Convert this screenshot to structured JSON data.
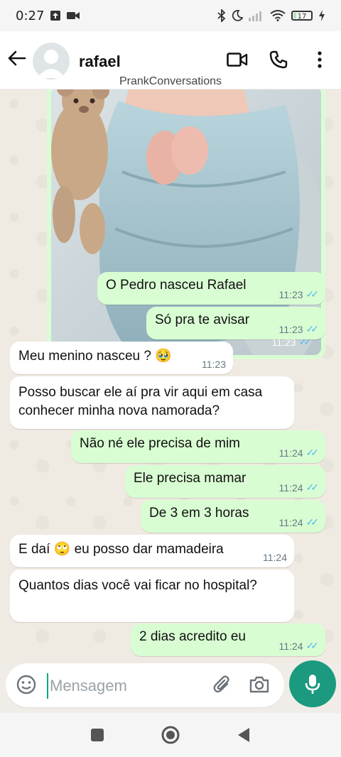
{
  "status_bar": {
    "time": "0:27",
    "battery": "17"
  },
  "header": {
    "contact_name": "rafael",
    "watermark": "PrankConversations"
  },
  "image_message": {
    "time": "11:23"
  },
  "messages": [
    {
      "direction": "out",
      "text": "O Pedro nasceu Rafael",
      "time": "11:23"
    },
    {
      "direction": "out",
      "text": "Só pra te avisar",
      "time": "11:23"
    },
    {
      "direction": "in",
      "text": "Meu menino nasceu ? 🥹",
      "time": "11:23"
    },
    {
      "direction": "in",
      "text": "Posso buscar ele aí pra vir aqui em casa conhecer minha nova namorada?",
      "time": ""
    },
    {
      "direction": "out",
      "text": "Não né ele precisa de mim",
      "time": "11:24"
    },
    {
      "direction": "out",
      "text": "Ele precisa mamar",
      "time": "11:24"
    },
    {
      "direction": "out",
      "text": "De 3 em 3 horas",
      "time": "11:24"
    },
    {
      "direction": "in",
      "text": "E daí 🙄 eu posso dar mamadeira",
      "time": "11:24"
    },
    {
      "direction": "in",
      "text": "Quantos dias você vai ficar no hospital?",
      "time": ""
    },
    {
      "direction": "out",
      "text": "2 dias acredito eu",
      "time": "11:24"
    }
  ],
  "composer": {
    "placeholder": "Mensagem"
  },
  "colors": {
    "outgoing": "#d9fdd3",
    "incoming": "#ffffff",
    "accent": "#1b9a7f",
    "read_check": "#53bdeb"
  },
  "icons": [
    "back-arrow-icon",
    "video-call-icon",
    "phone-icon",
    "more-icon",
    "emoji-icon",
    "attach-icon",
    "camera-icon",
    "mic-icon"
  ]
}
